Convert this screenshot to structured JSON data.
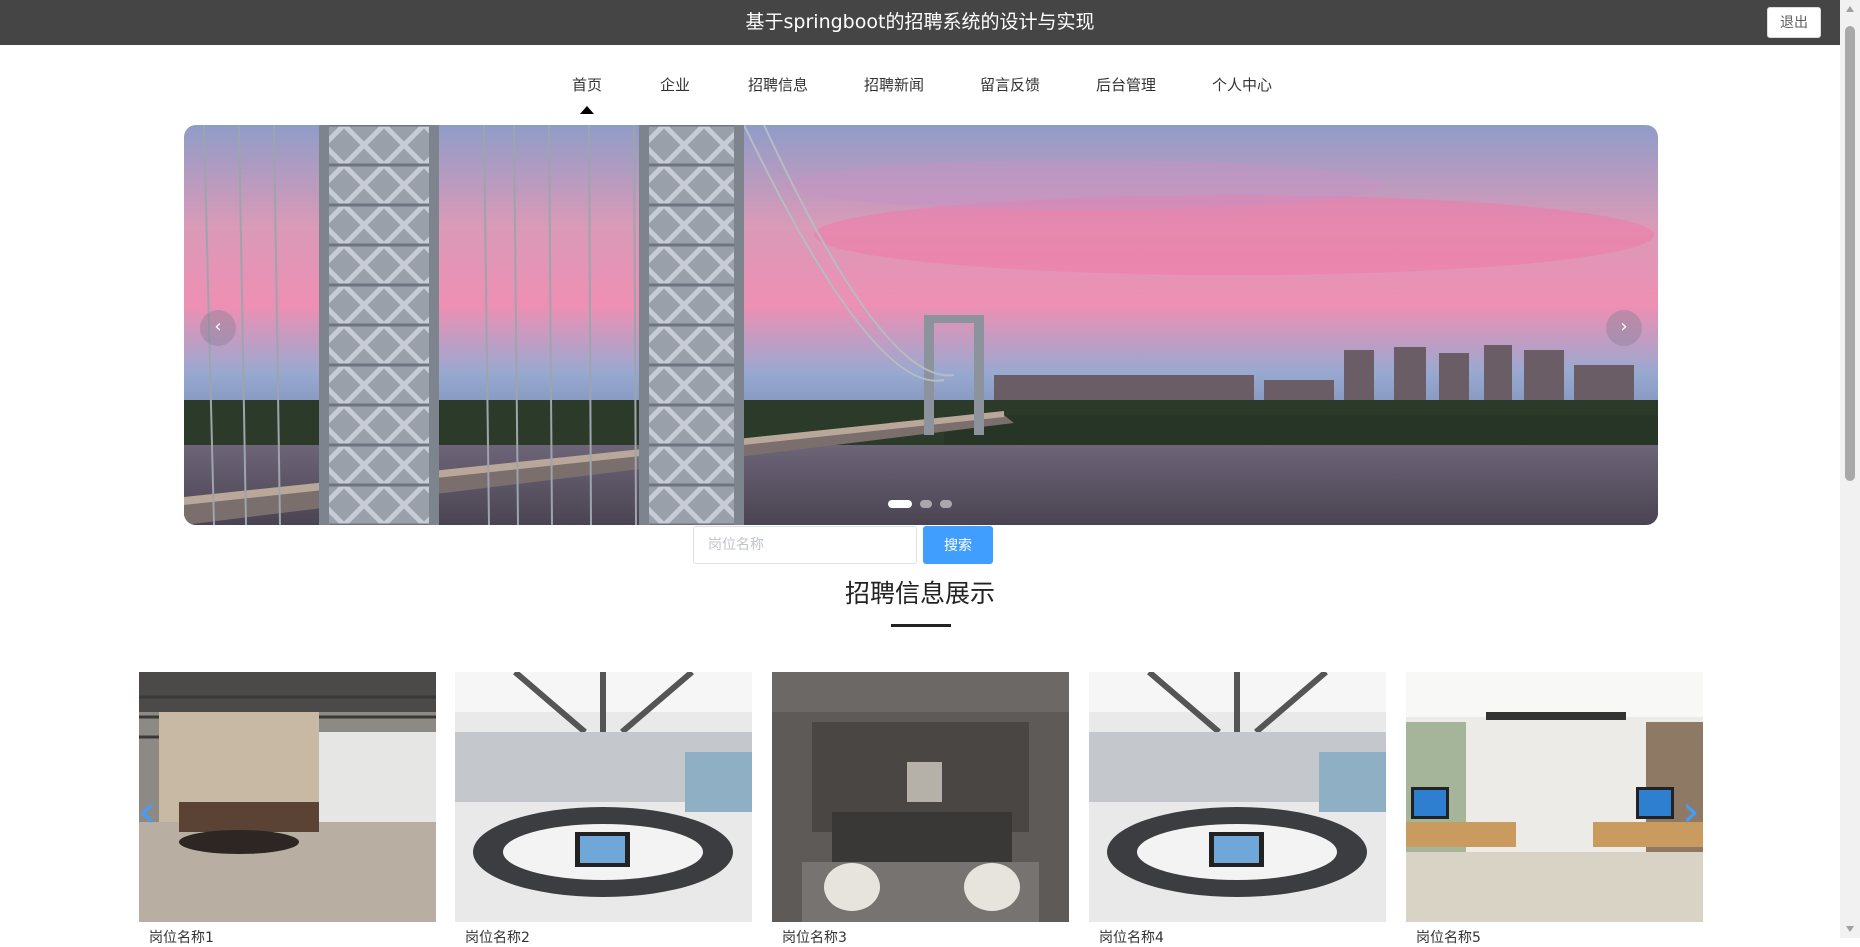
{
  "header": {
    "title": "基于springboot的招聘系统的设计与实现",
    "logout_label": "退出"
  },
  "nav": {
    "items": [
      {
        "label": "首页",
        "active": true
      },
      {
        "label": "企业"
      },
      {
        "label": "招聘信息"
      },
      {
        "label": "招聘新闻"
      },
      {
        "label": "留言反馈"
      },
      {
        "label": "后台管理"
      },
      {
        "label": "个人中心"
      }
    ]
  },
  "carousel": {
    "prev_icon": "‹",
    "next_icon": "›",
    "slide_count": 3,
    "active_slide": 1
  },
  "search": {
    "placeholder": "岗位名称",
    "value": "",
    "button_label": "搜索"
  },
  "section": {
    "title": "招聘信息展示"
  },
  "cards": [
    {
      "label": "岗位名称1"
    },
    {
      "label": "岗位名称2"
    },
    {
      "label": "岗位名称3"
    },
    {
      "label": "岗位名称4"
    },
    {
      "label": "岗位名称5"
    }
  ],
  "colors": {
    "header_bg": "#454545",
    "accent": "#409eff"
  }
}
